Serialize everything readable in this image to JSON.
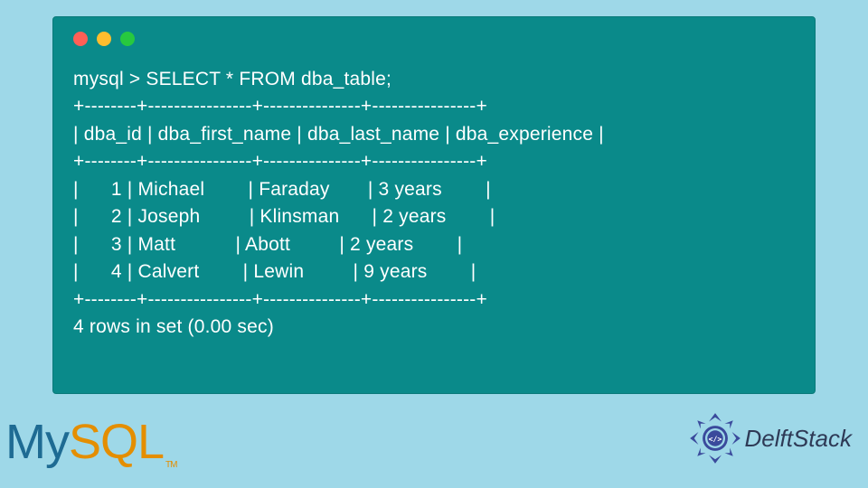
{
  "terminal": {
    "command": "mysql > SELECT * FROM dba_table;",
    "divider": "+--------+----------------+---------------+----------------+",
    "header": "| dba_id | dba_first_name | dba_last_name | dba_experience |",
    "rows": [
      "|      1 | Michael        | Faraday       | 3 years        |",
      "|      2 | Joseph         | Klinsman      | 2 years        |",
      "|      3 | Matt           | Abott         | 2 years        |",
      "|      4 | Calvert        | Lewin         | 9 years        |"
    ],
    "footer": "4 rows in set (0.00 sec)"
  },
  "logos": {
    "mysql_my": "My",
    "mysql_sql": "SQL",
    "mysql_tm": "TM",
    "delft": "DelftStack"
  },
  "chart_data": {
    "type": "table",
    "title": "dba_table",
    "columns": [
      "dba_id",
      "dba_first_name",
      "dba_last_name",
      "dba_experience"
    ],
    "rows": [
      [
        1,
        "Michael",
        "Faraday",
        "3 years"
      ],
      [
        2,
        "Joseph",
        "Klinsman",
        "2 years"
      ],
      [
        3,
        "Matt",
        "Abott",
        "2 years"
      ],
      [
        4,
        "Calvert",
        "Lewin",
        "9 years"
      ]
    ],
    "row_count": 4,
    "query_time_sec": 0.0
  }
}
